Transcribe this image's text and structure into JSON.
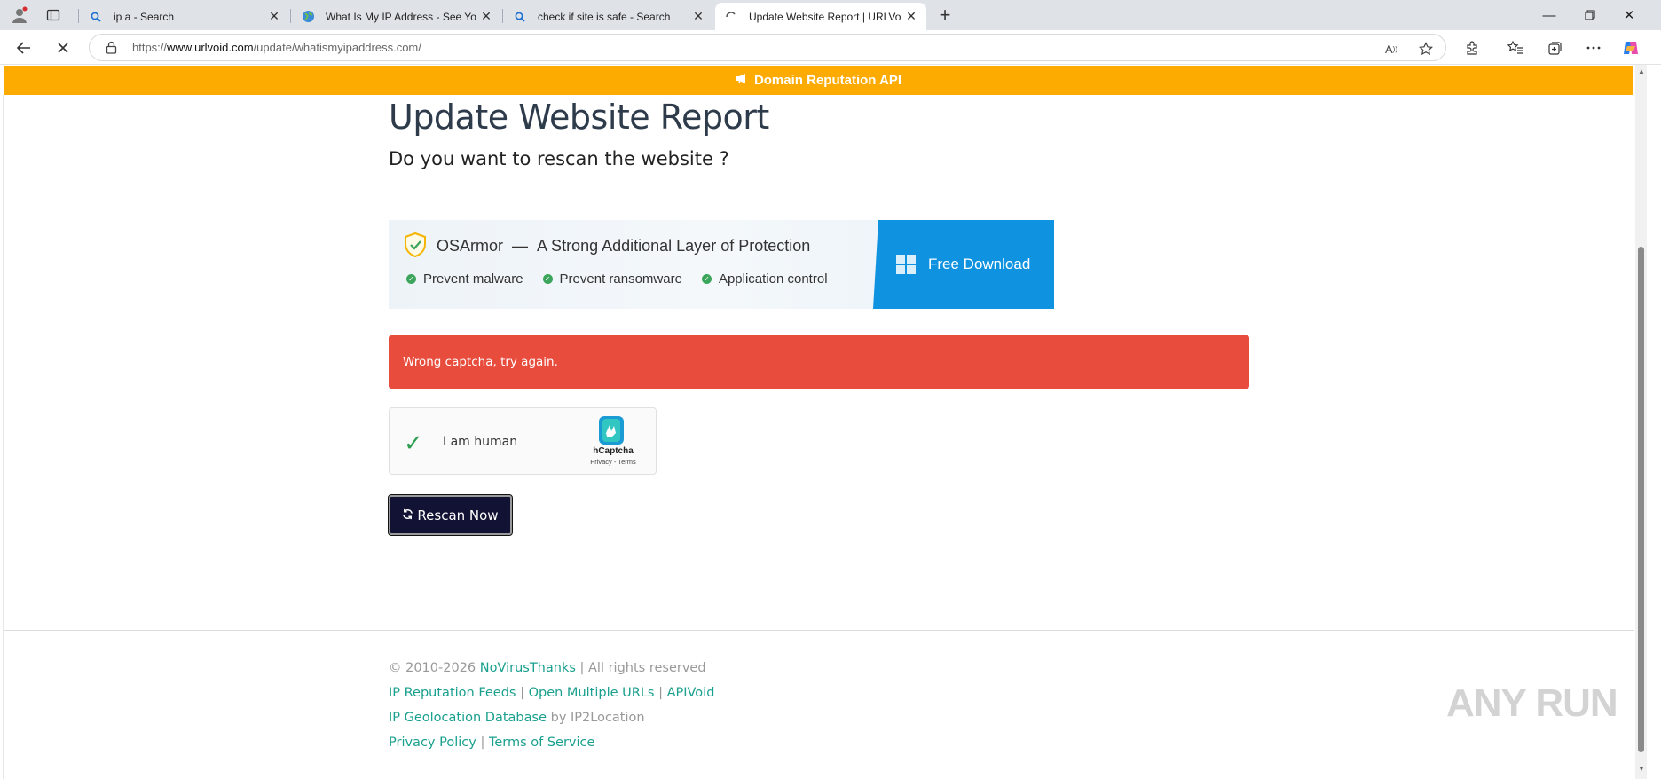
{
  "browser": {
    "tabs": [
      {
        "title": "ip a - Search",
        "favicon": "search-icon"
      },
      {
        "title": "What Is My IP Address - See Your",
        "favicon": "globe-icon"
      },
      {
        "title": "check if site is safe - Search",
        "favicon": "search-icon"
      },
      {
        "title": "Update Website Report | URLVoid",
        "favicon": "loading-icon",
        "active": true
      }
    ],
    "url_prefix": "https://",
    "url_host": "www.urlvoid.com",
    "url_path": "/update/whatismyipaddress.com/"
  },
  "page": {
    "banner_text": "Domain Reputation API",
    "title": "Update Website Report",
    "subtitle": "Do you want to rescan the website ?",
    "ad": {
      "brand": "OSArmor",
      "dash": "—",
      "tagline": "A Strong Additional Layer of Protection",
      "features": [
        "Prevent malware",
        "Prevent ransomware",
        "Application control"
      ],
      "cta": "Free Download"
    },
    "alert": "Wrong captcha, try again.",
    "captcha": {
      "label": "I am human",
      "brand": "hCaptcha",
      "links": "Privacy - Terms"
    },
    "rescan_button": "Rescan Now",
    "footer": {
      "copyright": "© 2010-2026",
      "company": "NoVirusThanks",
      "rights": "| All rights reserved",
      "link1": "IP Reputation Feeds",
      "link2": "Open Multiple URLs",
      "link3": "APIVoid",
      "link4": "IP Geolocation Database",
      "by_text": "by IP2Location",
      "link5": "Privacy Policy",
      "link6": "Terms of Service",
      "sep": "|"
    },
    "watermark": "ANY RUN"
  }
}
